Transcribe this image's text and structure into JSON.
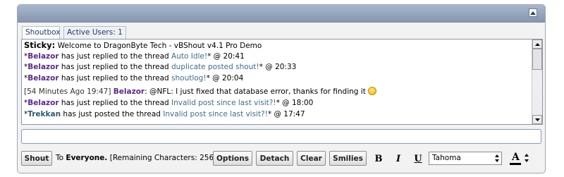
{
  "header": {
    "collapse_icon": "collapse-up-icon"
  },
  "tabs": [
    {
      "label": "Shoutbox",
      "active": true
    },
    {
      "label": "Active Users: 1",
      "active": false
    }
  ],
  "messages": [
    {
      "type": "sticky",
      "label": "Sticky:",
      "text": "Welcome to DragonByte Tech - vBShout v4.1 Pro Demo"
    },
    {
      "pre": "*",
      "user": "Belazor",
      "mid": " has just replied to the thread ",
      "link": "Auto Idle!",
      "post": "* @ 20:41"
    },
    {
      "pre": "*",
      "user": "Belazor",
      "mid": " has just replied to the thread ",
      "link": "duplicate posted shout!",
      "post": "* @ 20:33"
    },
    {
      "pre": "*",
      "user": "Belazor",
      "mid": " has just replied to the thread ",
      "link": "shoutlog!",
      "post": "* @ 20:04"
    },
    {
      "type": "chat",
      "time": "[54 Minutes Ago 19:47]",
      "user": "Belazor",
      "text": ": @NFL: I just fixed that database error, thanks for finding it"
    },
    {
      "pre": "*",
      "user": "Belazor",
      "mid": " has just replied to the thread ",
      "link": "Invalid post since last visit?!",
      "post": "* @ 18:00"
    },
    {
      "pre": "*",
      "user": "Trekkan",
      "mid": " has just posted the thread ",
      "link": "Invalid post since last visit?!",
      "post": "* @ 17:47"
    }
  ],
  "input": {
    "value": "",
    "placeholder": ""
  },
  "toolbar": {
    "shout_label": "Shout",
    "to_label": "To ",
    "to_target": "Everyone.",
    "remaining": "[Remaining Characters: 256]",
    "options_label": "Options",
    "detach_label": "Detach",
    "clear_label": "Clear",
    "smilies_label": "Smilies",
    "bold_label": "B",
    "italic_label": "I",
    "underline_label": "U",
    "font_value": "Tahoma",
    "color_label": "A"
  },
  "colors": {
    "header": "#8596ae",
    "username": "#5a2a88",
    "username_alt": "#2d5a6e",
    "link": "#3d6e8a"
  }
}
